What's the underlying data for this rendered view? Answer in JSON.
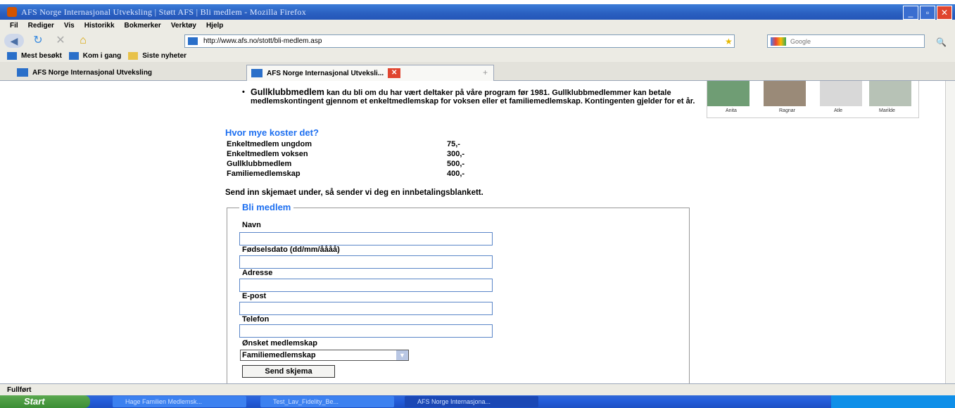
{
  "window": {
    "title": "AFS Norge Internasjonal Utveksling | Støtt AFS | Bli medlem - Mozilla Firefox"
  },
  "menu": [
    "Fil",
    "Rediger",
    "Vis",
    "Historikk",
    "Bokmerker",
    "Verktøy",
    "Hjelp"
  ],
  "nav": {
    "url": "http://www.afs.no/stott/bli-medlem.asp",
    "search_placeholder": "Google"
  },
  "bookmarks": [
    "Mest besøkt",
    "Kom i gang",
    "Siste nyheter"
  ],
  "tabs": [
    {
      "label": "AFS Norge Internasjonal Utveksling"
    },
    {
      "label": "AFS Norge Internasjonal Utveksli..."
    }
  ],
  "content": {
    "bullet_term": "Gullklubbmedlem",
    "bullet_text": " kan du bli om du har vært deltaker på våre program før 1981. Gullklubbmedlemmer kan betale medlemskontingent gjennom et enkeltmedlemskap for voksen eller et familiemedlemskap. Kontingenten gjelder for et år.",
    "price_heading": "Hvor mye koster det?",
    "prices": [
      {
        "label": "Enkeltmedlem ungdom",
        "value": "75,-"
      },
      {
        "label": "Enkeltmedlem voksen",
        "value": "300,-"
      },
      {
        "label": "Gullklubbmedlem",
        "value": "500,-"
      },
      {
        "label": "Familiemedlemskap",
        "value": "400,-"
      }
    ],
    "send_text": "Send inn skjemaet under, så sender vi deg en innbetalingsblankett."
  },
  "form": {
    "legend": "Bli medlem",
    "fields": [
      {
        "label": "Navn",
        "value": ""
      },
      {
        "label": "Fødselsdato (dd/mm/åååå)",
        "value": ""
      },
      {
        "label": "Adresse",
        "value": ""
      },
      {
        "label": "E-post",
        "value": ""
      },
      {
        "label": "Telefon",
        "value": ""
      }
    ],
    "membership_label": "Ønsket medlemskap",
    "membership_value": "Familiemedlemskap",
    "submit": "Send skjema"
  },
  "photos": [
    "Anita",
    "Ragnar",
    "Atle",
    "Marilde"
  ],
  "status": "Fullført",
  "taskbar": {
    "start": "Start",
    "tasks": [
      "Hage Familien Medlemsk...",
      "Test_Lav_Fidelity_Be...",
      "AFS Norge Internasjona..."
    ]
  }
}
